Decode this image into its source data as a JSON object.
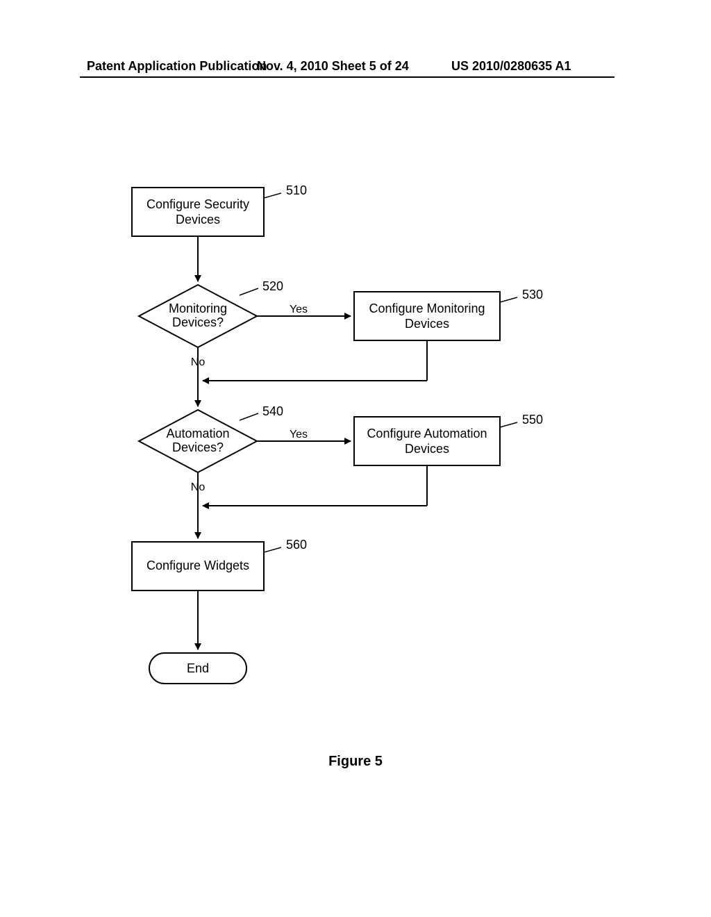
{
  "header": {
    "left": "Patent Application Publication",
    "center": "Nov. 4, 2010  Sheet 5 of 24",
    "right": "US 2010/0280635 A1"
  },
  "labels": {
    "yes": "Yes",
    "no": "No"
  },
  "flow": {
    "step510": {
      "ref": "510",
      "line1": "Configure Security",
      "line2": "Devices"
    },
    "decision520": {
      "ref": "520",
      "line1": "Monitoring",
      "line2": "Devices?"
    },
    "step530": {
      "ref": "530",
      "line1": "Configure Monitoring",
      "line2": "Devices"
    },
    "decision540": {
      "ref": "540",
      "line1": "Automation",
      "line2": "Devices?"
    },
    "step550": {
      "ref": "550",
      "line1": "Configure Automation",
      "line2": "Devices"
    },
    "step560": {
      "ref": "560",
      "line1": "Configure Widgets"
    },
    "end": {
      "label": "End"
    }
  },
  "figure": {
    "caption": "Figure 5"
  }
}
